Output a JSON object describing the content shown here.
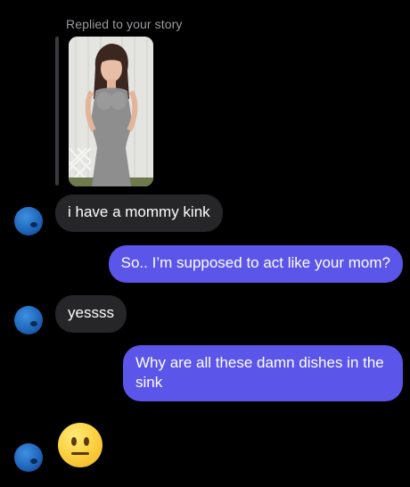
{
  "thread": {
    "reply_label": "Replied to your story"
  },
  "messages": [
    {
      "id": "m1",
      "direction": "incoming",
      "text": "i have a mommy kink"
    },
    {
      "id": "m2",
      "direction": "outgoing",
      "text": "So.. I’m supposed to act like your mom?"
    },
    {
      "id": "m3",
      "direction": "incoming",
      "text": "yessss"
    },
    {
      "id": "m4",
      "direction": "outgoing",
      "text": "Why are all these damn dishes in the sink"
    },
    {
      "id": "m5",
      "direction": "incoming",
      "emoji": "neutral-face"
    }
  ],
  "colors": {
    "background": "#000000",
    "incoming_bubble": "#262628",
    "outgoing_bubble": "#5b55ea",
    "reply_label": "#9a9aa0"
  },
  "icons": {
    "avatar": "avatar-icon",
    "emoji": "neutral-face-emoji-icon"
  }
}
